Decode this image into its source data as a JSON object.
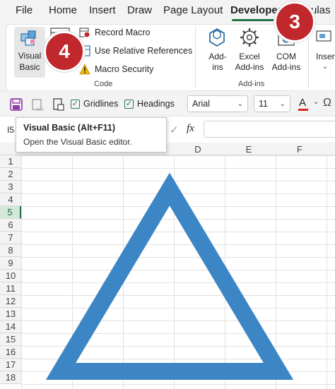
{
  "menu": {
    "tabs": [
      {
        "label": "File"
      },
      {
        "label": "Home"
      },
      {
        "label": "Insert"
      },
      {
        "label": "Draw"
      },
      {
        "label": "Page Layout"
      },
      {
        "label": "Developer"
      },
      {
        "label": "ulas"
      }
    ],
    "active_tab": "Developer"
  },
  "ribbon": {
    "code_group": {
      "label": "Code",
      "visual_basic": {
        "line1": "Visual",
        "line2": "Basic"
      },
      "record_macro": "Record Macro",
      "relative_refs": "Use Relative References",
      "macro_security": "Macro Security"
    },
    "addins_group": {
      "label": "Add-ins",
      "addins": {
        "line1": "Add-",
        "line2": "ins"
      },
      "excel_addins": {
        "line1": "Excel",
        "line2": "Add-ins"
      },
      "com_addins": {
        "line1": "COM",
        "line2": "Add-ins"
      }
    },
    "insert": {
      "label": "Insert"
    }
  },
  "badges": {
    "step3": "3",
    "step4": "4"
  },
  "toolbar": {
    "gridlines": "Gridlines",
    "headings": "Headings",
    "font": "Arial",
    "font_size": "11"
  },
  "formula_bar": {
    "name_box": "I5",
    "fx": "fx"
  },
  "tooltip": {
    "title": "Visual Basic (Alt+F11)",
    "description": "Open the Visual Basic editor."
  },
  "grid": {
    "columns": [
      "D",
      "E",
      "F"
    ],
    "rows": [
      "1",
      "2",
      "3",
      "4",
      "5",
      "6",
      "7",
      "8",
      "9",
      "10",
      "11",
      "12",
      "13",
      "14",
      "15",
      "16",
      "17",
      "18"
    ],
    "selected_row": "5"
  },
  "colors": {
    "accent": "#217346",
    "badge": "#c0282d",
    "shape": "#3d86c6"
  },
  "shape": {
    "type": "triangle-outline",
    "icon": "triangle-icon"
  }
}
